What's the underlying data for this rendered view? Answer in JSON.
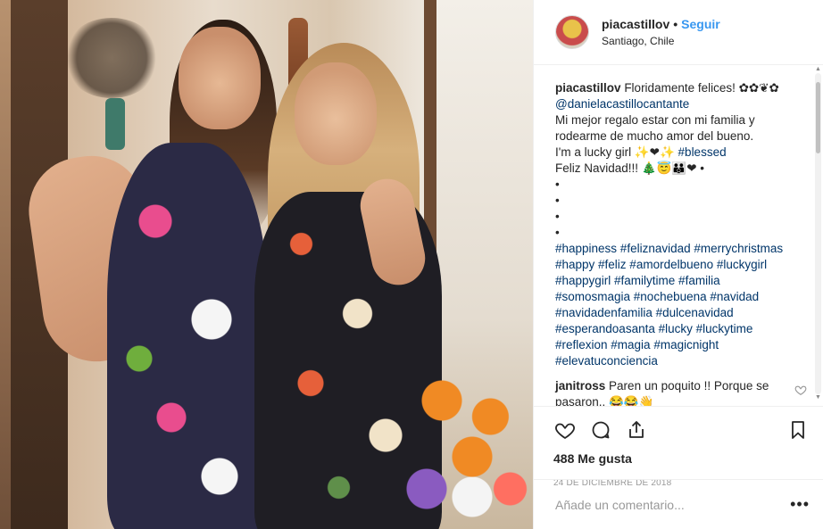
{
  "post": {
    "photo_alt": "",
    "username": "piacastillov",
    "separator": "•",
    "follow_label": "Seguir",
    "location": "Santiago, Chile"
  },
  "caption": {
    "username": "piacastillov",
    "line1": "Floridamente felices! ✿✿❦✿",
    "mention": "@danielacastillocantante",
    "line3": "Mi mejor regalo estar con mi familia y rodearme de mucho amor del bueno.",
    "line4_text": "I'm a lucky girl ✨❤✨",
    "line4_hashtag": "#blessed",
    "line5": "Feliz Navidad!!! 🎄😇👪❤ •",
    "bullets": [
      "•",
      "•",
      "•",
      "•"
    ],
    "hashtags": "#happiness #feliznavidad #merrychristmas #happy #feliz #amordelbueno #luckygirl #happygirl #familytime #familia #somosmagia #nochebuena #navidad #navidadenfamilia #dulcenavidad #esperandoasanta #lucky #luckytime #reflexion #magia #magicnight #elevatuconciencia"
  },
  "comment": {
    "username": "janitross",
    "text": "Paren un poquito !! Porque se pasaron.. 😂😂👋"
  },
  "actions": {
    "likes": "488 Me gusta",
    "date": "24 DE DICIEMBRE DE 2018"
  },
  "add_comment": {
    "placeholder": "Añade un comentario...",
    "more": "•••"
  },
  "icons": {
    "like": "heart-icon",
    "comment": "comment-icon",
    "share": "share-icon",
    "save": "bookmark-icon",
    "comment_like": "small-heart-icon"
  },
  "colors": {
    "link": "#3897f0",
    "hashtag": "#003569",
    "muted": "#999999",
    "text": "#262626"
  }
}
